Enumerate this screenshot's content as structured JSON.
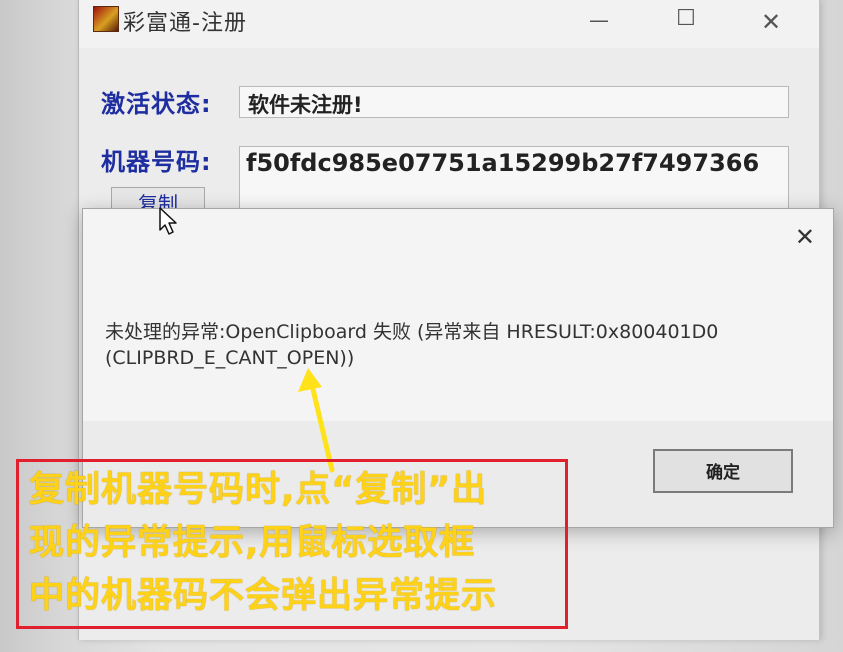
{
  "registration_window": {
    "title": "彩富通-注册",
    "minimize_glyph": "—",
    "maximize_glyph": "☐",
    "close_glyph": "✕",
    "activation_status_label": "激活状态:",
    "activation_status_value": "软件未注册!",
    "machine_code_label": "机器号码:",
    "machine_code_value": "f50fdc985e07751a15299b27f7497366",
    "copy_button_label": "复制"
  },
  "error_dialog": {
    "close_glyph": "✕",
    "message_line1": "未处理的异常:OpenClipboard 失败 (异常来自 HRESULT:0x800401D0",
    "message_line2": "(CLIPBRD_E_CANT_OPEN))",
    "ok_button_label": "确定"
  },
  "annotation": {
    "line1": "复制机器号码时,点“复制”出",
    "line2": "现的异常提示,用鼠标选取框",
    "line3": "中的机器码不会弹出异常提示",
    "text_color": "#ffd21a",
    "border_color": "#e0202c",
    "arrow_color": "#ffe21a"
  },
  "icons": {
    "app": "app-icon",
    "cursor": "mouse-pointer-icon",
    "arrow": "annotation-arrow"
  }
}
